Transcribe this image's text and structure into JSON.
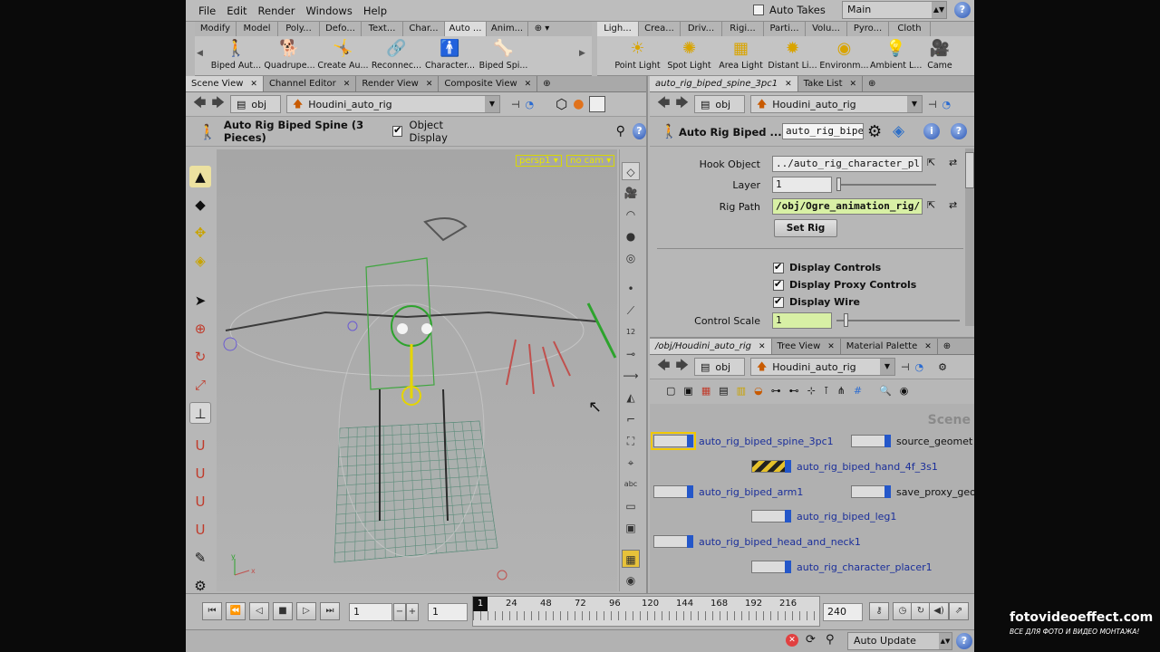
{
  "menubar": {
    "menus": [
      "File",
      "Edit",
      "Render",
      "Windows",
      "Help"
    ],
    "auto_takes_label": "Auto Takes",
    "desktop": "Main",
    "help_icon": "help-icon"
  },
  "shelf_left": {
    "tabs": [
      "Modify",
      "Model",
      "Poly...",
      "Defo...",
      "Text...",
      "Char...",
      "Auto ...",
      "Anim..."
    ],
    "active_tab": 6,
    "tools": [
      {
        "label": "Biped Aut...",
        "icon": "biped-icon",
        "glyph": "🚶"
      },
      {
        "label": "Quadrupe...",
        "icon": "quadruped-icon",
        "glyph": "🐕"
      },
      {
        "label": "Create Au...",
        "icon": "create-auto-rig-icon",
        "glyph": "🤸"
      },
      {
        "label": "Reconnec...",
        "icon": "reconnect-icon",
        "glyph": "🔗"
      },
      {
        "label": "Character...",
        "icon": "character-icon",
        "glyph": "🚹"
      },
      {
        "label": "Biped Spi...",
        "icon": "biped-spine-icon",
        "glyph": "🦴"
      }
    ]
  },
  "shelf_right": {
    "tabs": [
      "Ligh...",
      "Crea...",
      "Driv...",
      "Rigi...",
      "Parti...",
      "Volu...",
      "Pyro...",
      "Cloth"
    ],
    "active_tab": 0,
    "tools": [
      {
        "label": "Point Light",
        "icon": "point-light-icon",
        "glyph": "☀"
      },
      {
        "label": "Spot Light",
        "icon": "spot-light-icon",
        "glyph": "✺"
      },
      {
        "label": "Area Light",
        "icon": "area-light-icon",
        "glyph": "▦"
      },
      {
        "label": "Distant Li...",
        "icon": "distant-light-icon",
        "glyph": "✹"
      },
      {
        "label": "Environm...",
        "icon": "environment-light-icon",
        "glyph": "◉"
      },
      {
        "label": "Ambient L...",
        "icon": "ambient-light-icon",
        "glyph": "💡"
      },
      {
        "label": "Came",
        "icon": "camera-icon",
        "glyph": "🎥"
      }
    ]
  },
  "scene_pane": {
    "tabs": [
      "Scene View",
      "Channel Editor",
      "Render View",
      "Composite View"
    ],
    "path_root": "obj",
    "path_node": "Houdini_auto_rig",
    "tool_title": "Auto Rig Biped Spine (3 Pieces)",
    "object_display_label": "Object Display",
    "camera_menu_1": "persp1",
    "camera_menu_2": "no cam"
  },
  "param_pane": {
    "tabs": [
      "auto_rig_biped_spine_3pc1",
      "Take List"
    ],
    "path_root": "obj",
    "path_node": "Houdini_auto_rig",
    "node_type": "Auto Rig Biped ...",
    "node_name": "auto_rig_bipe",
    "hook_object_label": "Hook Object",
    "hook_object_value": "../auto_rig_character_pl",
    "layer_label": "Layer",
    "layer_value": "1",
    "layer_fraction": 0.0,
    "rig_path_label": "Rig Path",
    "rig_path_value": "/obj/Ogre_animation_rig/",
    "set_rig_label": "Set Rig",
    "display_controls_label": "Display Controls",
    "display_proxy_label": "Display Proxy Controls",
    "display_wire_label": "Display Wire",
    "control_scale_label": "Control Scale",
    "control_scale_value": "1"
  },
  "network_pane": {
    "tabs": [
      "/obj/Houdini_auto_rig",
      "Tree View",
      "Material Palette"
    ],
    "path_root": "obj",
    "path_node": "Houdini_auto_rig",
    "context_label": "Scene",
    "nodes": [
      {
        "label": "auto_rig_biped_spine_3pc1"
      },
      {
        "label": "source_geomet"
      },
      {
        "label": "auto_rig_biped_hand_4f_3s1"
      },
      {
        "label": "auto_rig_biped_arm1"
      },
      {
        "label": "save_proxy_geo"
      },
      {
        "label": "auto_rig_biped_leg1"
      },
      {
        "label": "auto_rig_biped_head_and_neck1"
      },
      {
        "label": "auto_rig_character_placer1"
      }
    ]
  },
  "timeline": {
    "current_frame": "1",
    "start_frame": "1",
    "end_frame": "240",
    "playhead_frame": "1",
    "ticks": [
      "24",
      "48",
      "72",
      "96",
      "120",
      "144",
      "168",
      "192",
      "216"
    ]
  },
  "statusbar": {
    "update_mode": "Auto Update"
  },
  "watermark": {
    "title": "fotovideoeffect.com",
    "subtitle": "ВСЕ ДЛЯ ФОТО И ВИДЕО МОНТАЖА!"
  }
}
